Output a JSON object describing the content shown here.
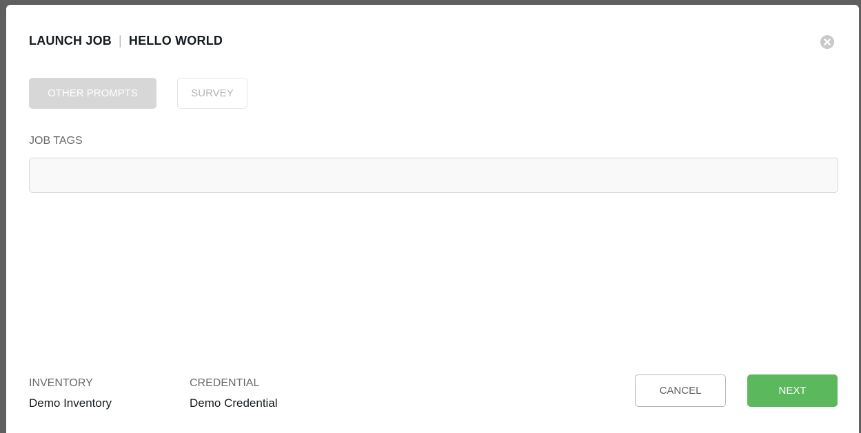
{
  "header": {
    "title": "LAUNCH JOB",
    "divider": "|",
    "job_name": "HELLO WORLD"
  },
  "close_icon": "close-circle-icon",
  "tabs": [
    {
      "label": "OTHER PROMPTS",
      "active": true
    },
    {
      "label": "SURVEY",
      "active": false
    }
  ],
  "job_tags": {
    "label": "JOB TAGS",
    "value": "",
    "placeholder": ""
  },
  "summary": {
    "inventory_label": "INVENTORY",
    "inventory_value": "Demo Inventory",
    "credential_label": "CREDENTIAL",
    "credential_value": "Demo Credential"
  },
  "actions": {
    "cancel_label": "CANCEL",
    "next_label": "NEXT"
  },
  "colors": {
    "next_button": "#5cb85c",
    "active_tab": "#d7d7d7",
    "close_icon": "#c9c9c9"
  }
}
